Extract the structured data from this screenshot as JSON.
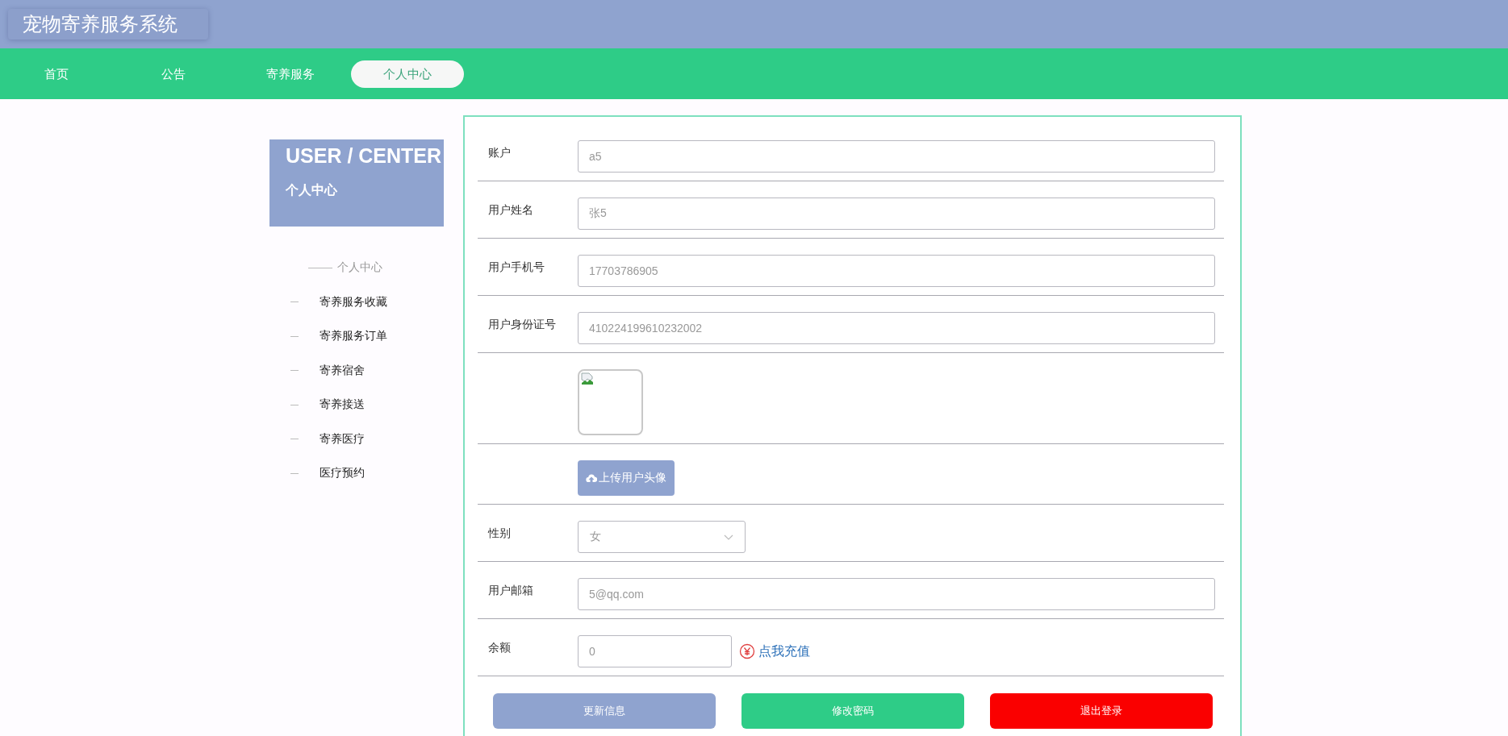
{
  "header": {
    "title": "宠物寄养服务系统"
  },
  "nav": [
    {
      "label": "首页",
      "selected": false
    },
    {
      "label": "公告",
      "selected": false
    },
    {
      "label": "寄养服务",
      "selected": false
    },
    {
      "label": "个人中心",
      "selected": true
    }
  ],
  "sidebar": {
    "title": "USER / CENTER",
    "subtitle": "个人中心",
    "items": [
      {
        "label": "个人中心",
        "selected": true
      },
      {
        "label": "寄养服务收藏",
        "selected": false
      },
      {
        "label": "寄养服务订单",
        "selected": false
      },
      {
        "label": "寄养宿舍",
        "selected": false
      },
      {
        "label": "寄养接送",
        "selected": false
      },
      {
        "label": "寄养医疗",
        "selected": false
      },
      {
        "label": "医疗预约",
        "selected": false
      }
    ]
  },
  "form": {
    "rows": [
      {
        "kind": "text",
        "label": "账户",
        "value": "a5"
      },
      {
        "kind": "text",
        "label": "用户姓名",
        "value": "张5"
      },
      {
        "kind": "text",
        "label": "用户手机号",
        "value": "17703786905"
      },
      {
        "kind": "text",
        "label": "用户身份证号",
        "value": "410224199610232002"
      },
      {
        "kind": "image"
      },
      {
        "kind": "upload",
        "button": "上传用户头像"
      },
      {
        "kind": "select",
        "label": "性别",
        "value": "女"
      },
      {
        "kind": "text",
        "label": "用户邮箱",
        "value": "5@qq.com"
      },
      {
        "kind": "balance",
        "label": "余额",
        "value": "0",
        "link": "点我充值"
      }
    ],
    "buttons": [
      {
        "label": "更新信息",
        "kind": "primary"
      },
      {
        "label": "修改密码",
        "kind": "secondary"
      },
      {
        "label": "退出登录",
        "kind": "danger"
      }
    ]
  }
}
